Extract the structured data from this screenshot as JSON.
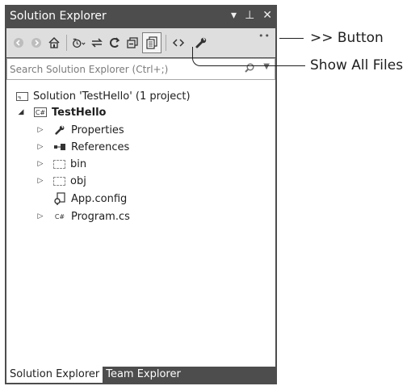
{
  "panel": {
    "title": "Solution Explorer",
    "controls": {
      "dropdown": "▾",
      "pin": "⊥",
      "close": "✕"
    }
  },
  "toolbar": {
    "overflow": "••",
    "buttons": [
      {
        "icon": "back-arrow-icon",
        "glyph": "◉",
        "disabled": true
      },
      {
        "icon": "forward-arrow-icon",
        "glyph": "◉",
        "disabled": true
      },
      {
        "icon": "home-icon",
        "glyph": "⌂",
        "disabled": false
      },
      {
        "icon": "pending-changes-filter-icon",
        "glyph": "↻",
        "disabled": false
      },
      {
        "icon": "sync-icon",
        "glyph": "⇄",
        "disabled": false
      },
      {
        "icon": "refresh-icon",
        "glyph": "⟳",
        "disabled": false
      },
      {
        "icon": "collapse-all-icon",
        "glyph": "⧉",
        "disabled": false
      },
      {
        "icon": "show-all-files-icon",
        "glyph": "▤",
        "disabled": false
      },
      {
        "icon": "view-code-icon",
        "glyph": "‹›",
        "disabled": false
      },
      {
        "icon": "properties-wrench-icon",
        "glyph": "🔧",
        "disabled": false
      }
    ]
  },
  "search": {
    "placeholder": "Search Solution Explorer (Ctrl+;)",
    "value": ""
  },
  "tree": {
    "items": [
      {
        "label": "Solution 'TestHello' (1 project)",
        "icon": "solution-icon",
        "glyph": "⊞",
        "expander": ""
      },
      {
        "label": "TestHello",
        "icon": "csharp-project-icon",
        "glyph": "C#",
        "expander": "◢",
        "bold": true
      },
      {
        "label": "Properties",
        "icon": "wrench-icon",
        "glyph": "🔧",
        "expander": "▷"
      },
      {
        "label": "References",
        "icon": "references-icon",
        "glyph": "▪▪",
        "expander": "▷"
      },
      {
        "label": "bin",
        "icon": "folder-icon",
        "glyph": "",
        "expander": "▷"
      },
      {
        "label": "obj",
        "icon": "folder-icon",
        "glyph": "",
        "expander": "▷"
      },
      {
        "label": "App.config",
        "icon": "config-file-icon",
        "glyph": "⚙",
        "expander": ""
      },
      {
        "label": "Program.cs",
        "icon": "csharp-file-icon",
        "glyph": "C#",
        "expander": "▷"
      }
    ]
  },
  "tabs": [
    {
      "label": "Solution Explorer",
      "active": true
    },
    {
      "label": "Team Explorer",
      "active": false
    }
  ],
  "callouts": {
    "overflow_button": ">> Button",
    "show_all_files": "Show All Files"
  }
}
